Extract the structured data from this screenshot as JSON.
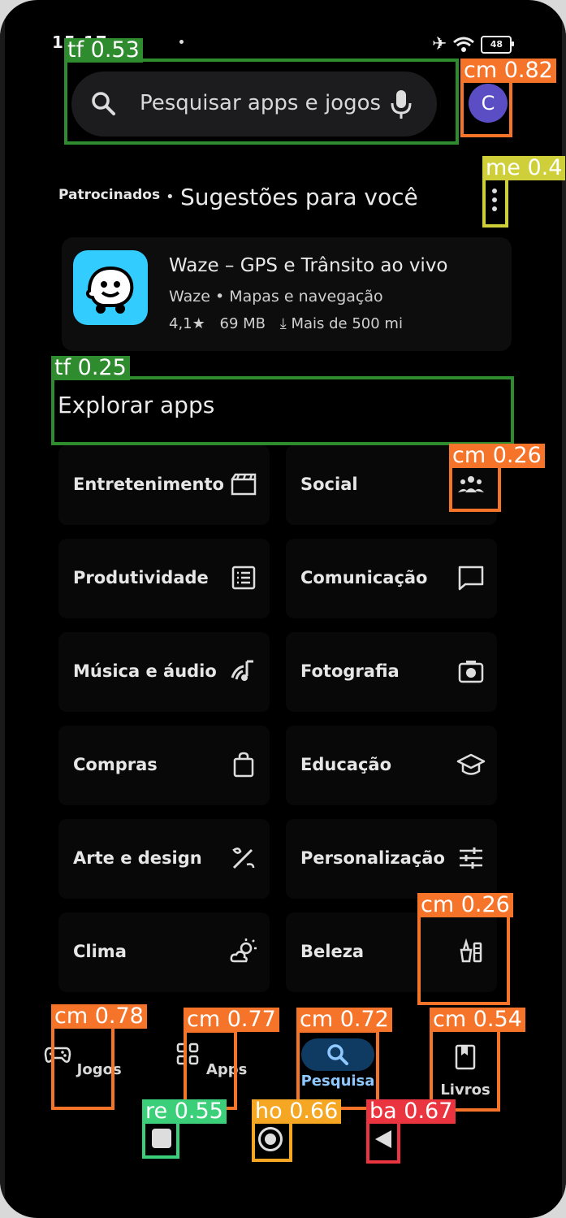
{
  "status_bar": {
    "time": "15:17",
    "battery": "48"
  },
  "search": {
    "placeholder": "Pesquisar apps e jogos"
  },
  "account": {
    "initial": "C"
  },
  "suggestions": {
    "sponsored_label": "Patrocinados",
    "separator": "•",
    "title": "Sugestões para você",
    "app": {
      "name": "Waze – GPS e Trânsito ao vivo",
      "developer": "Waze",
      "category": "Mapas e navegação",
      "rating": "4,1",
      "size": "69 MB",
      "installs": "Mais de 500 mi"
    }
  },
  "explore": {
    "title": "Explorar apps",
    "categories": [
      {
        "label": "Entretenimento",
        "icon": "clapperboard-icon"
      },
      {
        "label": "Social",
        "icon": "people-icon"
      },
      {
        "label": "Produtividade",
        "icon": "list-icon"
      },
      {
        "label": "Comunicação",
        "icon": "chat-icon"
      },
      {
        "label": "Música e áudio",
        "icon": "music-note-icon"
      },
      {
        "label": "Fotografia",
        "icon": "camera-icon"
      },
      {
        "label": "Compras",
        "icon": "shopping-bag-icon"
      },
      {
        "label": "Educação",
        "icon": "graduation-cap-icon"
      },
      {
        "label": "Arte e design",
        "icon": "brush-icon"
      },
      {
        "label": "Personalização",
        "icon": "sliders-icon"
      },
      {
        "label": "Clima",
        "icon": "partly-cloudy-icon"
      },
      {
        "label": "Beleza",
        "icon": "cosmetics-icon"
      }
    ]
  },
  "bottom_nav": [
    {
      "label": "Jogos",
      "icon": "gamepad-icon"
    },
    {
      "label": "Apps",
      "icon": "apps-grid-icon"
    },
    {
      "label": "Pesquisa",
      "icon": "search-icon",
      "active": true
    },
    {
      "label": "Livros",
      "icon": "book-icon"
    }
  ],
  "detections": {
    "search_field": "tf 0.53",
    "avatar": "cm 0.82",
    "more_menu": "me 0.4",
    "explore_title": "tf 0.25",
    "social_icon": "cm 0.26",
    "beauty_icon": "cm 0.26",
    "nav_games": "cm 0.78",
    "nav_apps": "cm 0.77",
    "nav_search": "cm 0.72",
    "nav_books": "cm 0.54",
    "recents": "re 0.55",
    "home": "ho 0.66",
    "back": "ba 0.67"
  },
  "colors": {
    "background": "#000000",
    "card": "#0d0d0d",
    "accent": "#8ec8ff",
    "active_pill": "#0f3b63",
    "waze_blue": "#33ccff"
  }
}
